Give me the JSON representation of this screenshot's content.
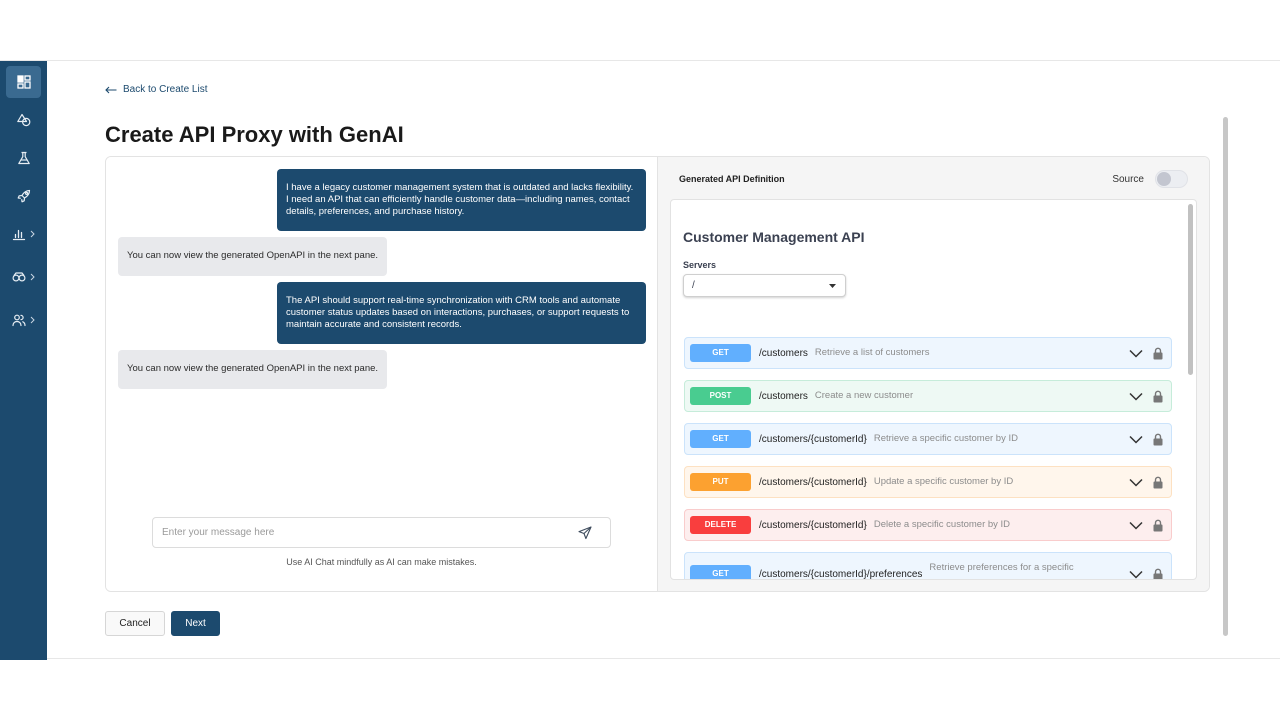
{
  "sidebar": {
    "items": [
      {
        "icon": "dashboard-icon",
        "active": true,
        "has_submenu": false
      },
      {
        "icon": "shapes-icon",
        "active": false,
        "has_submenu": false
      },
      {
        "icon": "flask-icon",
        "active": false,
        "has_submenu": false
      },
      {
        "icon": "rocket-icon",
        "active": false,
        "has_submenu": false
      },
      {
        "icon": "bar-chart-icon",
        "active": false,
        "has_submenu": true
      },
      {
        "icon": "infinity-icon",
        "active": false,
        "has_submenu": true
      },
      {
        "icon": "users-icon",
        "active": false,
        "has_submenu": true
      }
    ]
  },
  "back_link": {
    "icon": "arrow-left-icon",
    "label": "Back to Create List"
  },
  "page_title": "Create API Proxy with GenAI",
  "chat": {
    "messages": [
      {
        "role": "user",
        "text": "I have a legacy customer management system that is outdated and lacks flexibility. I need an API that can efficiently handle customer data—including names, contact details, preferences, and purchase history."
      },
      {
        "role": "assistant",
        "text": "You can now view the generated OpenAPI in the next pane."
      },
      {
        "role": "user",
        "text": "The API should support real-time synchronization with CRM tools and automate customer status updates based on interactions, purchases, or support requests to maintain accurate and consistent records."
      },
      {
        "role": "assistant",
        "text": "You can now view the generated OpenAPI in the next pane."
      }
    ],
    "input_value": "",
    "input_placeholder": "Enter your message here",
    "send_icon": "send-icon",
    "disclaimer": "Use AI Chat mindfully as AI can make mistakes."
  },
  "definition": {
    "heading": "Generated API Definition",
    "source_label": "Source",
    "source_toggle_on": false,
    "api_title": "Customer Management API",
    "servers_label": "Servers",
    "server_selected": "/",
    "operations": [
      {
        "method": "GET",
        "path": "/customers",
        "summary": "Retrieve a list of customers"
      },
      {
        "method": "POST",
        "path": "/customers",
        "summary": "Create a new customer"
      },
      {
        "method": "GET",
        "path": "/customers/{customerId}",
        "summary": "Retrieve a specific customer by ID"
      },
      {
        "method": "PUT",
        "path": "/customers/{customerId}",
        "summary": "Update a specific customer by ID"
      },
      {
        "method": "DELETE",
        "path": "/customers/{customerId}",
        "summary": "Delete a specific customer by ID"
      },
      {
        "method": "GET",
        "path": "/customers/{customerId}/preferences",
        "summary": "Retrieve preferences for a specific"
      }
    ],
    "method_colors": {
      "GET": {
        "badge": "#61affe",
        "row_bg": "#eef6fe",
        "row_border": "#cbe3fb"
      },
      "POST": {
        "badge": "#49cc90",
        "row_bg": "#eef9f4",
        "row_border": "#c6ecda"
      },
      "PUT": {
        "badge": "#fca130",
        "row_bg": "#fff6ec",
        "row_border": "#fde1c2"
      },
      "DELETE": {
        "badge": "#f93e3e",
        "row_bg": "#fdeeee",
        "row_border": "#f9cccc"
      }
    }
  },
  "actions": {
    "cancel_label": "Cancel",
    "next_label": "Next"
  },
  "colors": {
    "brand": "#1c4a6e",
    "brand_active": "#3a6a90",
    "assistant_bubble": "#e8e9ec",
    "definition_pane": "#f5f5f5"
  }
}
